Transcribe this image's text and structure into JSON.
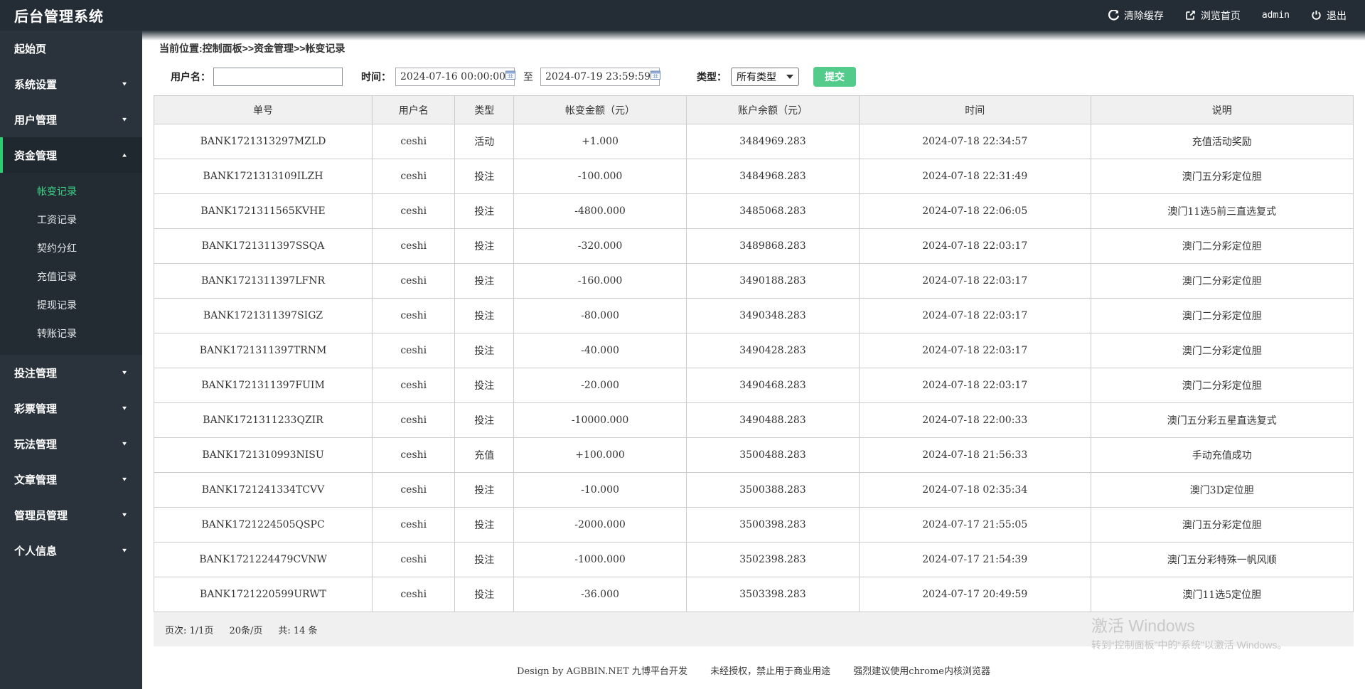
{
  "topbar": {
    "title": "后台管理系统",
    "clear_cache": "清除缓存",
    "browse_home": "浏览首页",
    "username": "admin",
    "logout": "退出"
  },
  "sidebar": {
    "items": [
      {
        "label": "起始页",
        "chevron": "none",
        "active": false
      },
      {
        "label": "系统设置",
        "chevron": "down",
        "active": false
      },
      {
        "label": "用户管理",
        "chevron": "down",
        "active": false
      },
      {
        "label": "资金管理",
        "chevron": "up",
        "active": true,
        "children": [
          "帐变记录",
          "工资记录",
          "契约分红",
          "充值记录",
          "提现记录",
          "转账记录"
        ],
        "active_child": "帐变记录"
      },
      {
        "label": "投注管理",
        "chevron": "down",
        "active": false
      },
      {
        "label": "彩票管理",
        "chevron": "down",
        "active": false
      },
      {
        "label": "玩法管理",
        "chevron": "down",
        "active": false
      },
      {
        "label": "文章管理",
        "chevron": "down",
        "active": false
      },
      {
        "label": "管理员管理",
        "chevron": "down",
        "active": false
      },
      {
        "label": "个人信息",
        "chevron": "down",
        "active": false
      }
    ]
  },
  "breadcrumb": "当前位置:控制面板>>资金管理>>帐变记录",
  "filters": {
    "username_label": "用户名：",
    "username_value": "",
    "time_label": "时间：",
    "time_from": "2024-07-16 00:00:00",
    "to_label": "至",
    "time_to": "2024-07-19 23:59:59",
    "type_label": "类型：",
    "type_value": "所有类型",
    "submit_label": "提交"
  },
  "table": {
    "headers": [
      "单号",
      "用户名",
      "类型",
      "帐变金额（元）",
      "账户余额（元）",
      "时间",
      "说明"
    ],
    "rows": [
      [
        "BANK1721313297MZLD",
        "ceshi",
        "活动",
        "+1.000",
        "3484969.283",
        "2024-07-18 22:34:57",
        "充值活动奖励"
      ],
      [
        "BANK1721313109ILZH",
        "ceshi",
        "投注",
        "-100.000",
        "3484968.283",
        "2024-07-18 22:31:49",
        "澳门五分彩定位胆"
      ],
      [
        "BANK1721311565KVHE",
        "ceshi",
        "投注",
        "-4800.000",
        "3485068.283",
        "2024-07-18 22:06:05",
        "澳门11选5前三直选复式"
      ],
      [
        "BANK1721311397SSQA",
        "ceshi",
        "投注",
        "-320.000",
        "3489868.283",
        "2024-07-18 22:03:17",
        "澳门二分彩定位胆"
      ],
      [
        "BANK1721311397LFNR",
        "ceshi",
        "投注",
        "-160.000",
        "3490188.283",
        "2024-07-18 22:03:17",
        "澳门二分彩定位胆"
      ],
      [
        "BANK1721311397SIGZ",
        "ceshi",
        "投注",
        "-80.000",
        "3490348.283",
        "2024-07-18 22:03:17",
        "澳门二分彩定位胆"
      ],
      [
        "BANK1721311397TRNM",
        "ceshi",
        "投注",
        "-40.000",
        "3490428.283",
        "2024-07-18 22:03:17",
        "澳门二分彩定位胆"
      ],
      [
        "BANK1721311397FUIM",
        "ceshi",
        "投注",
        "-20.000",
        "3490468.283",
        "2024-07-18 22:03:17",
        "澳门二分彩定位胆"
      ],
      [
        "BANK1721311233QZIR",
        "ceshi",
        "投注",
        "-10000.000",
        "3490488.283",
        "2024-07-18 22:00:33",
        "澳门五分彩五星直选复式"
      ],
      [
        "BANK1721310993NISU",
        "ceshi",
        "充值",
        "+100.000",
        "3500488.283",
        "2024-07-18 21:56:33",
        "手动充值成功"
      ],
      [
        "BANK1721241334TCVV",
        "ceshi",
        "投注",
        "-10.000",
        "3500388.283",
        "2024-07-18 02:35:34",
        "澳门3D定位胆"
      ],
      [
        "BANK1721224505QSPC",
        "ceshi",
        "投注",
        "-2000.000",
        "3500398.283",
        "2024-07-17 21:55:05",
        "澳门五分彩定位胆"
      ],
      [
        "BANK1721224479CVNW",
        "ceshi",
        "投注",
        "-1000.000",
        "3502398.283",
        "2024-07-17 21:54:39",
        "澳门五分彩特殊一帆风顺"
      ],
      [
        "BANK1721220599URWT",
        "ceshi",
        "投注",
        "-36.000",
        "3503398.283",
        "2024-07-17 20:49:59",
        "澳门11选5定位胆"
      ]
    ]
  },
  "pagination": {
    "page": "页次: 1/1页",
    "per_page": "20条/页",
    "total": "共: 14  条"
  },
  "footer": {
    "design": "Design by AGBBIN.NET 九博平台开发",
    "license": "未经授权，禁止用于商业用途",
    "advice": "强烈建议使用chrome内核浏览器"
  },
  "watermark": {
    "line1": "激活 Windows",
    "line2": "转到“控制面板”中的“系统”以激活 Windows。"
  },
  "colors": {
    "topbar_bg": "#242d35",
    "sidebar_bg": "#2a333b",
    "submenu_bg": "#232b33",
    "accent_green": "#2ecc71",
    "active_link": "#3bd686",
    "submit_btn": "#52cb8b",
    "table_header_bg": "#f0f0f0",
    "table_border": "#cccccc"
  }
}
